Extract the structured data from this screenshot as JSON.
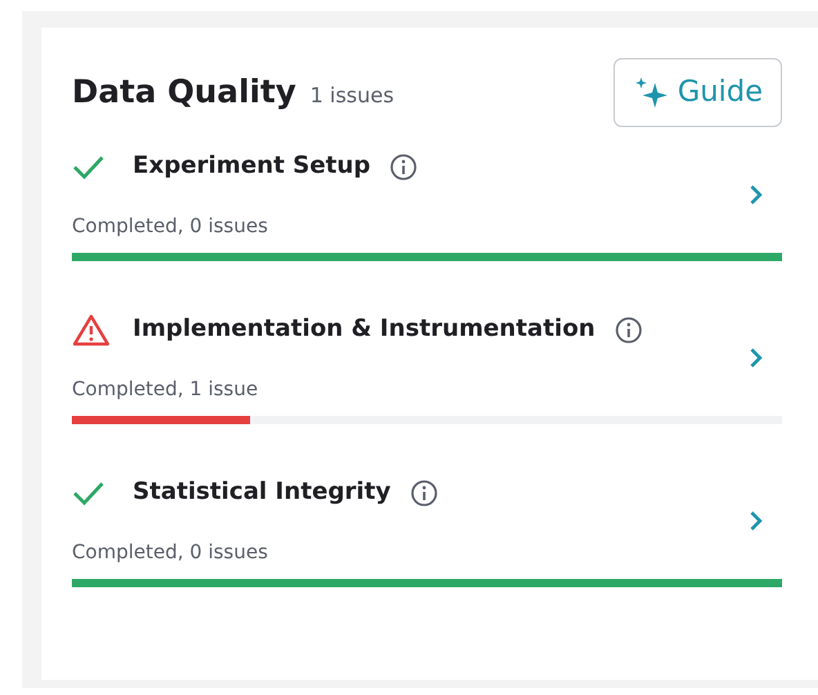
{
  "header": {
    "title": "Data Quality",
    "count": "1 issues",
    "guide_button": "Guide"
  },
  "checks": [
    {
      "title": "Experiment Setup",
      "kind": "ok",
      "summary": "Completed, 0 issues",
      "level": 1
    },
    {
      "title": "Implementation & Instrumentation",
      "kind": "warning",
      "summary": "Completed, 1 issue",
      "level": 0.25
    },
    {
      "title": "Statistical Integrity",
      "kind": "ok",
      "summary": "Completed, 0 issues",
      "level": 1
    }
  ]
}
